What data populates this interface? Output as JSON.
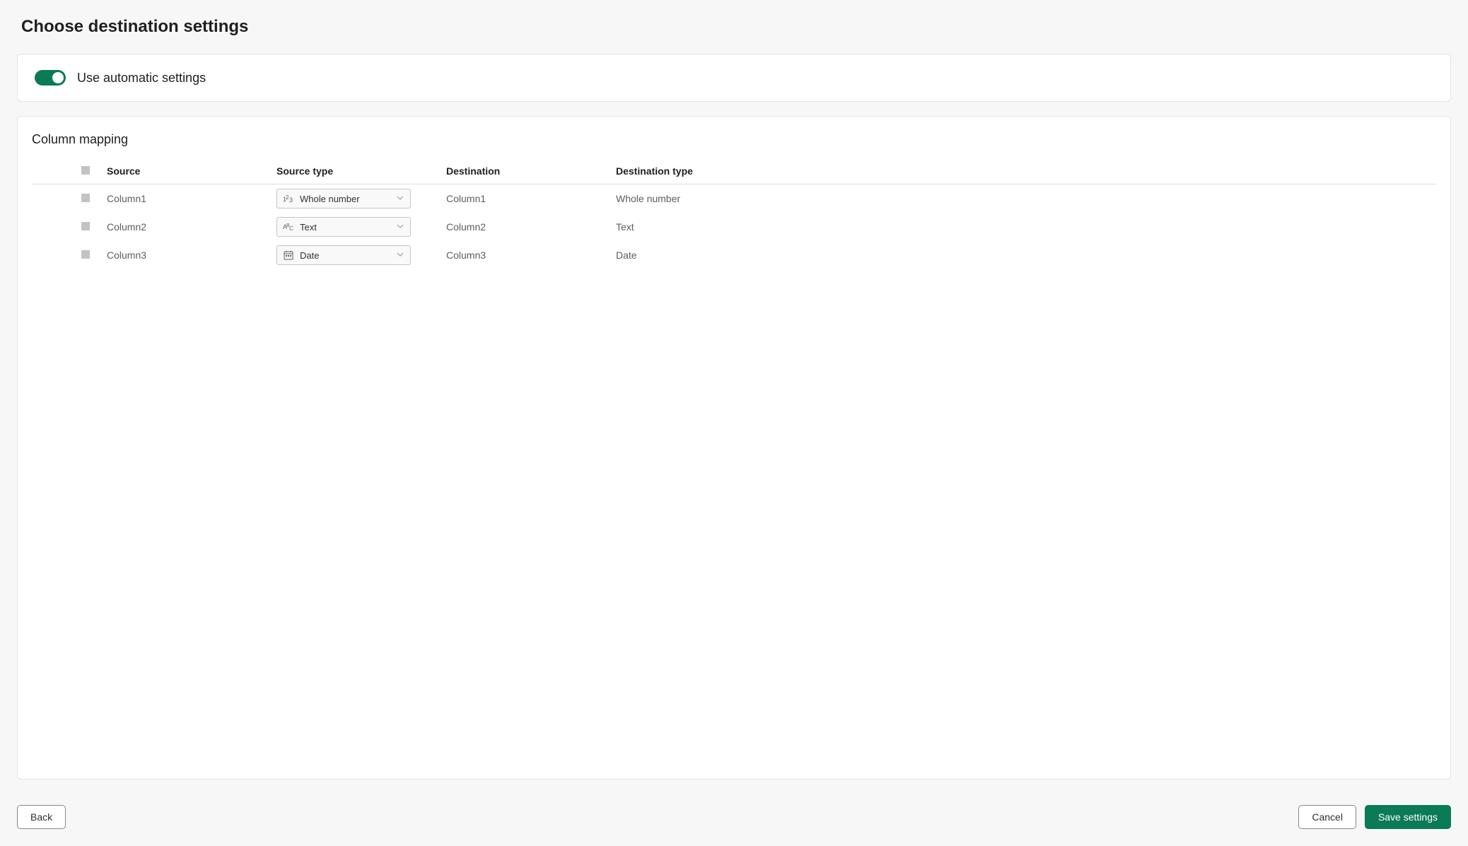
{
  "page_title": "Choose destination settings",
  "auto_settings": {
    "label": "Use automatic settings",
    "enabled": true
  },
  "column_mapping": {
    "title": "Column mapping",
    "headers": {
      "source": "Source",
      "source_type": "Source type",
      "destination": "Destination",
      "destination_type": "Destination type"
    },
    "rows": [
      {
        "source": "Column1",
        "source_type": "Whole number",
        "source_type_icon": "number",
        "destination": "Column1",
        "destination_type": "Whole number"
      },
      {
        "source": "Column2",
        "source_type": "Text",
        "source_type_icon": "text",
        "destination": "Column2",
        "destination_type": "Text"
      },
      {
        "source": "Column3",
        "source_type": "Date",
        "source_type_icon": "date",
        "destination": "Column3",
        "destination_type": "Date"
      }
    ]
  },
  "footer": {
    "back": "Back",
    "cancel": "Cancel",
    "save": "Save settings"
  }
}
